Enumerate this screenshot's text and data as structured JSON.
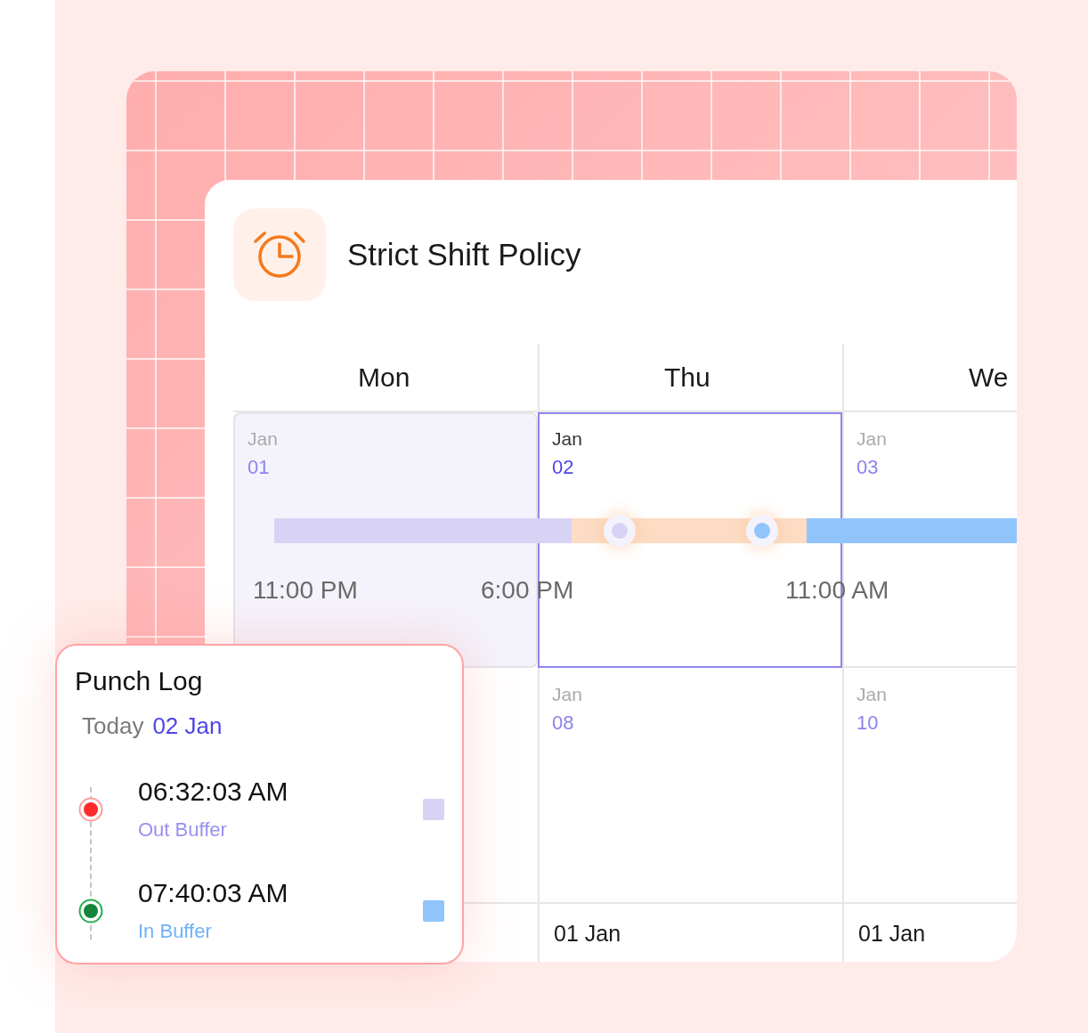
{
  "policy": {
    "title": "Strict Shift Policy"
  },
  "calendar": {
    "days": [
      {
        "label": "Mon"
      },
      {
        "label": "Thu"
      },
      {
        "label": "We"
      }
    ],
    "weeks": [
      {
        "cells": [
          {
            "month": "Jan",
            "day": "01",
            "selected": false,
            "shaded": true
          },
          {
            "month": "Jan",
            "day": "02",
            "selected": true,
            "shaded": false
          },
          {
            "month": "Jan",
            "day": "03",
            "selected": false,
            "shaded": false
          }
        ]
      },
      {
        "cells": [
          {
            "month": "Jan",
            "day": "08",
            "selected": false,
            "shaded": false
          },
          {
            "month": "Jan",
            "day": "10",
            "selected": false,
            "shaded": false
          }
        ]
      }
    ],
    "footer": [
      {
        "label": "01 Jan"
      },
      {
        "label": "01 Jan"
      }
    ]
  },
  "timeline": {
    "segments": [
      {
        "color": "#d8d3f5"
      },
      {
        "color": "#fcdcc4"
      },
      {
        "color": "#90c4fb"
      }
    ],
    "markers": [
      {
        "color": "#d8d3f5"
      },
      {
        "color": "#90c4fb"
      }
    ],
    "times": [
      "11:00 PM",
      "6:00 PM",
      "11:00 AM"
    ]
  },
  "punch_log": {
    "title": "Punch Log",
    "today_label": "Today",
    "date": "02 Jan",
    "entries": [
      {
        "kind": "out",
        "time": "06:32:03 AM",
        "label": "Out Buffer",
        "color": "#d8d3f5"
      },
      {
        "kind": "in",
        "time": "07:40:03 AM",
        "label": "In Buffer",
        "color": "#90c4fb"
      }
    ]
  }
}
